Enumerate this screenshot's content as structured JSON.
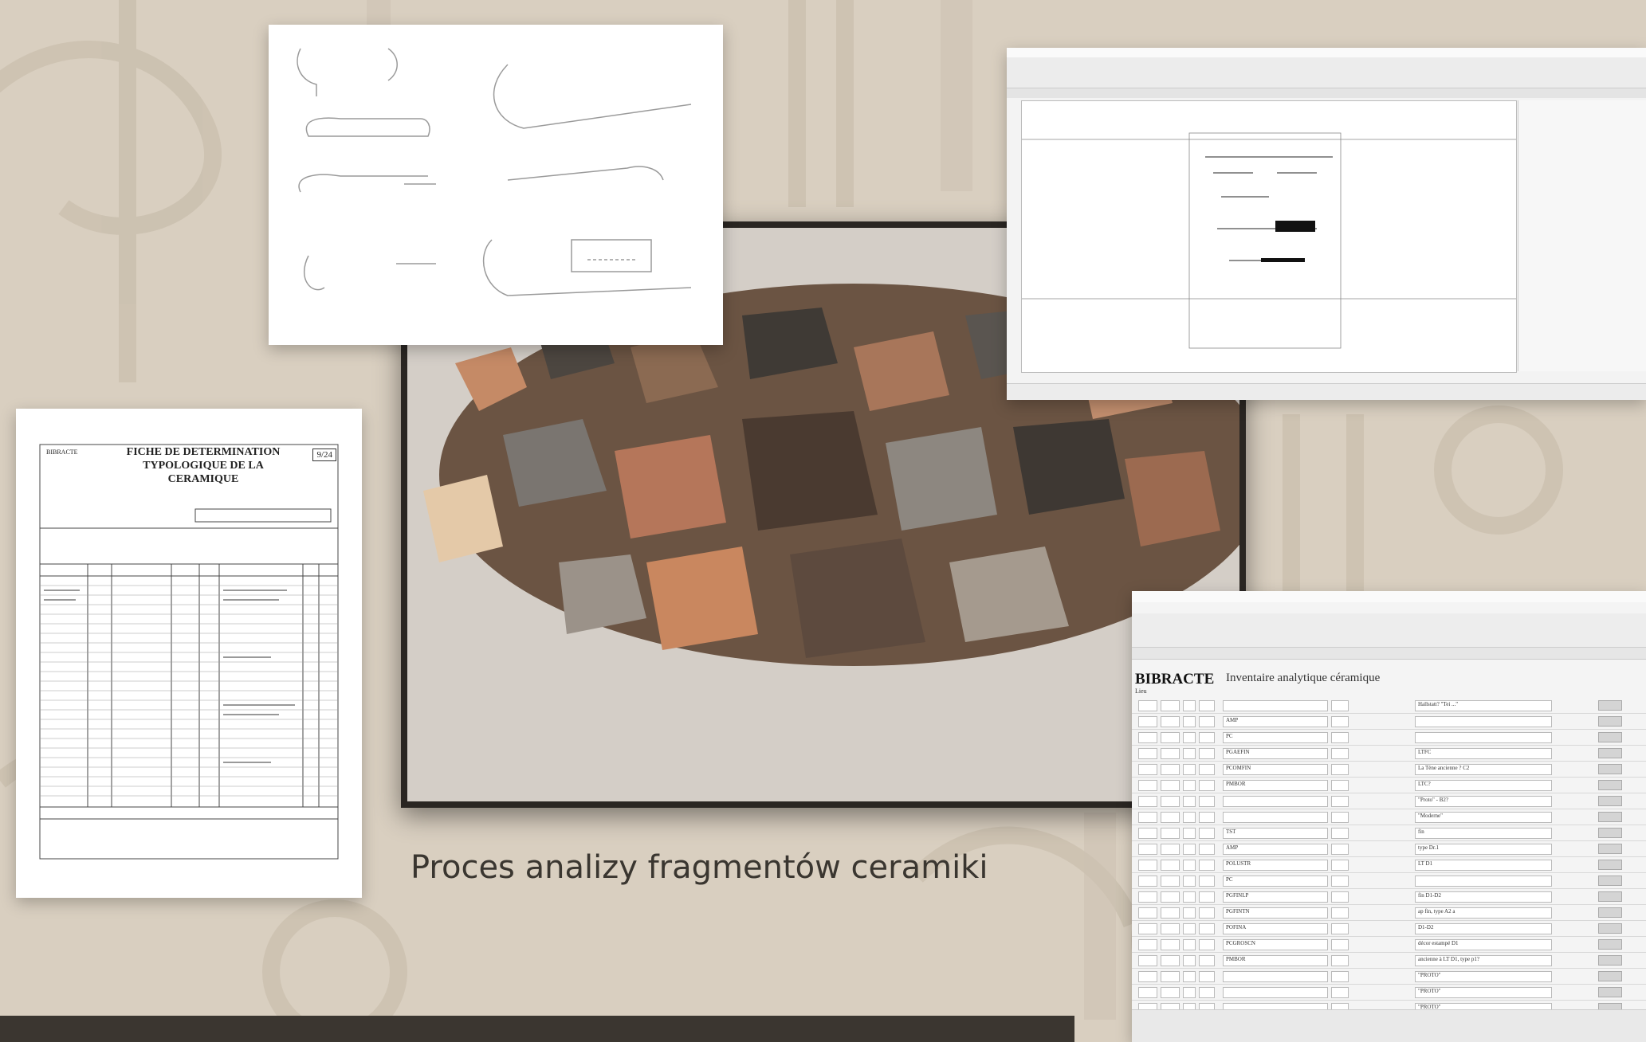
{
  "caption": "Proces analizy fragmentów ceramiki",
  "form": {
    "org": "BIBRACTE",
    "title_line1": "FICHE DE DETERMINATION",
    "title_line2": "TYPOLOGIQUE DE LA",
    "title_line3": "CERAMIQUE",
    "code": "9/24"
  },
  "database": {
    "brand": "BIBRACTE",
    "sub": "Lieu",
    "heading": "Inventaire analytique céramique",
    "rows": [
      {
        "cat": "",
        "comment": "Hallstatt? \"Tei ...\""
      },
      {
        "cat": "AMP",
        "comment": ""
      },
      {
        "cat": "PC",
        "comment": ""
      },
      {
        "cat": "PGAEFIN",
        "comment": "LTFC"
      },
      {
        "cat": "PCOMFIN",
        "comment": "La Tène ancienne ? C2"
      },
      {
        "cat": "PMBOR",
        "comment": "LTC?"
      },
      {
        "cat": "",
        "comment": "\"Proto\" - B2?"
      },
      {
        "cat": "",
        "comment": "\"Moderne\""
      },
      {
        "cat": "TST",
        "comment": "fin"
      },
      {
        "cat": "AMP",
        "comment": "type Dr.1"
      },
      {
        "cat": "POLUSTR",
        "comment": "LT D1"
      },
      {
        "cat": "PC",
        "comment": ""
      },
      {
        "cat": "PGFINLP",
        "comment": "fin D1-D2"
      },
      {
        "cat": "PGFINTN",
        "comment": "ap fin, type A2 a"
      },
      {
        "cat": "POFINA",
        "comment": "D1-D2"
      },
      {
        "cat": "PCGROSCN",
        "comment": "décor estampé D1"
      },
      {
        "cat": "PMBOR",
        "comment": "ancienne à LT D1, type p1?"
      },
      {
        "cat": "",
        "comment": "\"PROTO\""
      },
      {
        "cat": "",
        "comment": "\"PROTO\""
      },
      {
        "cat": "",
        "comment": "\"PROTO\""
      }
    ]
  },
  "colors": {
    "background": "#d9cfc0",
    "pattern": "#cbbfae",
    "band": "#3b3630",
    "frame": "#2a2622"
  }
}
